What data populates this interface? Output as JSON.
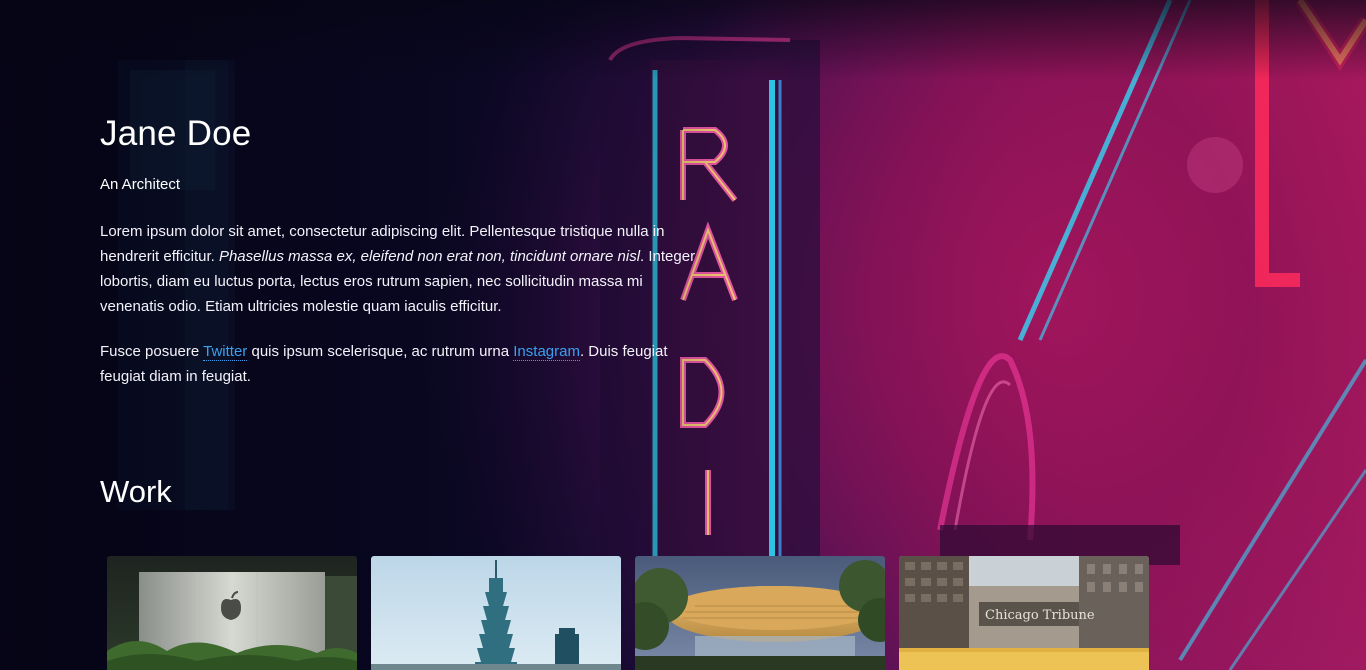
{
  "profile": {
    "name": "Jane Doe",
    "tagline": "An Architect"
  },
  "intro": {
    "p1_part1": "Lorem ipsum dolor sit amet, consectetur adipiscing elit. Pellentesque tristique nulla in hendrerit efficitur. ",
    "p1_italic": "Phasellus massa ex, eleifend non erat non, tincidunt ornare nisl",
    "p1_part2": ". Integer lobortis, diam eu luctus porta, lectus eros rutrum sapien, nec sollicitudin massa mi venenatis odio. Etiam ultricies molestie quam iaculis efficitur.",
    "p2_part1": "Fusce posuere ",
    "p2_link1": "Twitter",
    "p2_part2": " quis ipsum scelerisque, ac rutrum urna ",
    "p2_link2": "Instagram",
    "p2_part3": ". Duis feugiat feugiat diam in feugiat."
  },
  "work": {
    "title": "Work",
    "items": [
      {
        "icon": "apple-store-photo"
      },
      {
        "icon": "taipei-101-tower-photo"
      },
      {
        "icon": "disc-roof-pavilion-photo"
      },
      {
        "icon": "chicago-tribune-building-photo",
        "sign_text": "Chicago Tribune"
      }
    ]
  },
  "colors": {
    "link": "#3aa0f0",
    "neon_pink": "#ff3ea5",
    "neon_cyan": "#2fe2ff",
    "neon_yellow": "#ffe86a"
  }
}
